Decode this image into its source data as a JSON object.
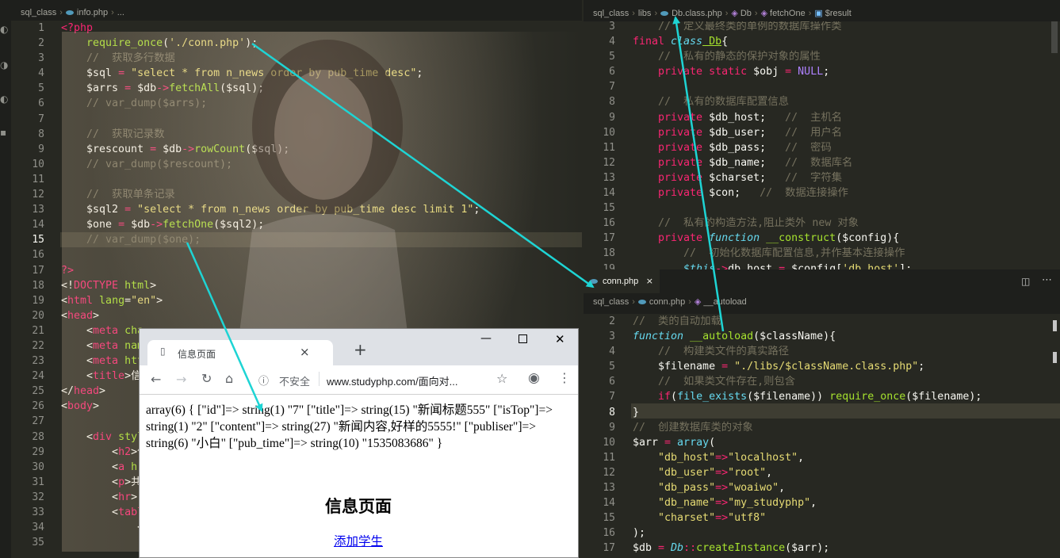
{
  "left_editor": {
    "breadcrumb": {
      "folder": "sql_class",
      "file": "info.php",
      "more": "..."
    },
    "lines": [
      {
        "n": "1",
        "t": [
          [
            "kw",
            "<?php"
          ]
        ]
      },
      {
        "n": "2",
        "t": [
          [
            "fn",
            "    require_once"
          ],
          [
            "vr",
            "("
          ],
          [
            "st",
            "'./conn.php'"
          ],
          [
            "vr",
            ");"
          ]
        ]
      },
      {
        "n": "3",
        "t": [
          [
            "cm",
            "    //  获取多行数据"
          ]
        ]
      },
      {
        "n": "4",
        "t": [
          [
            "vr",
            "    $sql "
          ],
          [
            "kw",
            "="
          ],
          [
            "st",
            " \"select * from n_news order by pub_time desc\""
          ],
          [
            "vr",
            ";"
          ]
        ]
      },
      {
        "n": "5",
        "t": [
          [
            "vr",
            "    $arrs "
          ],
          [
            "kw",
            "="
          ],
          [
            "vr",
            " $db"
          ],
          [
            "kw",
            "->"
          ],
          [
            "fn",
            "fetchAll"
          ],
          [
            "vr",
            "($sql);"
          ]
        ]
      },
      {
        "n": "6",
        "t": [
          [
            "cm",
            "    // var_dump($arrs);"
          ]
        ]
      },
      {
        "n": "7",
        "t": []
      },
      {
        "n": "8",
        "t": [
          [
            "cm",
            "    //  获取记录数"
          ]
        ]
      },
      {
        "n": "9",
        "t": [
          [
            "vr",
            "    $rescount "
          ],
          [
            "kw",
            "="
          ],
          [
            "vr",
            " $db"
          ],
          [
            "kw",
            "->"
          ],
          [
            "fn",
            "rowCount"
          ],
          [
            "vr",
            "($sql);"
          ]
        ]
      },
      {
        "n": "10",
        "t": [
          [
            "cm",
            "    // var_dump($rescount);"
          ]
        ]
      },
      {
        "n": "11",
        "t": []
      },
      {
        "n": "12",
        "t": [
          [
            "cm",
            "    //  获取单条记录"
          ]
        ]
      },
      {
        "n": "13",
        "t": [
          [
            "vr",
            "    $sql2 "
          ],
          [
            "kw",
            "="
          ],
          [
            "st",
            " \"select * from n_news order by pub_time desc limit 1\""
          ],
          [
            "vr",
            ";"
          ]
        ]
      },
      {
        "n": "14",
        "t": [
          [
            "vr",
            "    $one "
          ],
          [
            "kw",
            "="
          ],
          [
            "vr",
            " $db"
          ],
          [
            "kw",
            "->"
          ],
          [
            "fn",
            "fetchOne"
          ],
          [
            "vr",
            "($sql2);"
          ]
        ]
      },
      {
        "n": "15",
        "t": [
          [
            "cm",
            "    // var_dump($one);"
          ]
        ]
      },
      {
        "n": "16",
        "t": []
      },
      {
        "n": "17",
        "t": [
          [
            "kw",
            "?>"
          ]
        ]
      },
      {
        "n": "18",
        "t": [
          [
            "vr",
            "<!"
          ],
          [
            "kw",
            "DOCTYPE"
          ],
          [
            "fn",
            " html"
          ],
          [
            "vr",
            ">"
          ]
        ]
      },
      {
        "n": "19",
        "t": [
          [
            "vr",
            "<"
          ],
          [
            "kw",
            "html"
          ],
          [
            "fn",
            " lang"
          ],
          [
            "vr",
            "="
          ],
          [
            "st",
            "\"en\""
          ],
          [
            "vr",
            ">"
          ]
        ]
      },
      {
        "n": "20",
        "t": [
          [
            "vr",
            "<"
          ],
          [
            "kw",
            "head"
          ],
          [
            "vr",
            ">"
          ]
        ]
      },
      {
        "n": "21",
        "t": [
          [
            "vr",
            "    <"
          ],
          [
            "kw",
            "meta"
          ],
          [
            "fn",
            " cha"
          ]
        ]
      },
      {
        "n": "22",
        "t": [
          [
            "vr",
            "    <"
          ],
          [
            "kw",
            "meta"
          ],
          [
            "fn",
            " nam"
          ]
        ]
      },
      {
        "n": "23",
        "t": [
          [
            "vr",
            "    <"
          ],
          [
            "kw",
            "meta"
          ],
          [
            "fn",
            " htt"
          ]
        ]
      },
      {
        "n": "24",
        "t": [
          [
            "vr",
            "    <"
          ],
          [
            "kw",
            "title"
          ],
          [
            "vr",
            ">信"
          ]
        ]
      },
      {
        "n": "25",
        "t": [
          [
            "vr",
            "</"
          ],
          [
            "kw",
            "head"
          ],
          [
            "vr",
            ">"
          ]
        ]
      },
      {
        "n": "26",
        "t": [
          [
            "vr",
            "<"
          ],
          [
            "kw",
            "body"
          ],
          [
            "vr",
            ">"
          ]
        ]
      },
      {
        "n": "27",
        "t": []
      },
      {
        "n": "28",
        "t": [
          [
            "vr",
            "    <"
          ],
          [
            "kw",
            "div"
          ],
          [
            "fn",
            " styl"
          ]
        ]
      },
      {
        "n": "29",
        "t": [
          [
            "vr",
            "        <"
          ],
          [
            "kw",
            "h2"
          ],
          [
            "vr",
            ">信"
          ]
        ]
      },
      {
        "n": "30",
        "t": [
          [
            "vr",
            "        <"
          ],
          [
            "kw",
            "a"
          ],
          [
            "fn",
            " hr"
          ]
        ]
      },
      {
        "n": "31",
        "t": [
          [
            "vr",
            "        <"
          ],
          [
            "kw",
            "p"
          ],
          [
            "vr",
            ">共"
          ]
        ]
      },
      {
        "n": "32",
        "t": [
          [
            "vr",
            "        <"
          ],
          [
            "kw",
            "hr"
          ],
          [
            "vr",
            ">"
          ]
        ]
      },
      {
        "n": "33",
        "t": [
          [
            "vr",
            "        <"
          ],
          [
            "kw",
            "tabl"
          ]
        ]
      },
      {
        "n": "34",
        "t": [
          [
            "vr",
            "            <"
          ]
        ]
      },
      {
        "n": "35",
        "t": []
      }
    ]
  },
  "right_top_editor": {
    "breadcrumb": {
      "folder": "sql_class",
      "sub": "libs",
      "file": "Db.class.php",
      "cls": "Db",
      "method": "fetchOne",
      "var": "$result"
    },
    "lines": [
      {
        "n": "3",
        "t": [
          [
            "cm",
            "    //  定义最终类的单例的数据库操作类"
          ]
        ]
      },
      {
        "n": "4",
        "t": [
          [
            "kw",
            "final"
          ],
          [
            "ty",
            " class"
          ],
          [
            "cl",
            " Db"
          ],
          [
            "vr",
            "{"
          ]
        ]
      },
      {
        "n": "5",
        "t": [
          [
            "cm",
            "    //  私有的静态的保护对象的属性"
          ]
        ]
      },
      {
        "n": "6",
        "t": [
          [
            "kw",
            "    private static"
          ],
          [
            "vr",
            " $obj "
          ],
          [
            "kw",
            "="
          ],
          [
            "cn",
            " NULL"
          ],
          [
            "vr",
            ";"
          ]
        ]
      },
      {
        "n": "7",
        "t": []
      },
      {
        "n": "8",
        "t": [
          [
            "cm",
            "    //  私有的数据库配置信息"
          ]
        ]
      },
      {
        "n": "9",
        "t": [
          [
            "kw",
            "    private"
          ],
          [
            "vr",
            " $db_host;   "
          ],
          [
            "cm",
            "//  主机名"
          ]
        ]
      },
      {
        "n": "10",
        "t": [
          [
            "kw",
            "    private"
          ],
          [
            "vr",
            " $db_user;   "
          ],
          [
            "cm",
            "//  用户名"
          ]
        ]
      },
      {
        "n": "11",
        "t": [
          [
            "kw",
            "    private"
          ],
          [
            "vr",
            " $db_pass;   "
          ],
          [
            "cm",
            "//  密码"
          ]
        ]
      },
      {
        "n": "12",
        "t": [
          [
            "kw",
            "    private"
          ],
          [
            "vr",
            " $db_name;   "
          ],
          [
            "cm",
            "//  数据库名"
          ]
        ]
      },
      {
        "n": "13",
        "t": [
          [
            "kw",
            "    private"
          ],
          [
            "vr",
            " $charset;   "
          ],
          [
            "cm",
            "//  字符集"
          ]
        ]
      },
      {
        "n": "14",
        "t": [
          [
            "kw",
            "    private"
          ],
          [
            "vr",
            " $con;   "
          ],
          [
            "cm",
            "//  数据连接操作"
          ]
        ]
      },
      {
        "n": "15",
        "t": []
      },
      {
        "n": "16",
        "t": [
          [
            "cm",
            "    //  私有的构造方法,阻止类外 new 对象"
          ]
        ]
      },
      {
        "n": "17",
        "t": [
          [
            "kw",
            "    private"
          ],
          [
            "ty",
            " function"
          ],
          [
            "fn",
            " __construct"
          ],
          [
            "vr",
            "($config){"
          ]
        ]
      },
      {
        "n": "18",
        "t": [
          [
            "cm",
            "        //  初始化数据库配置信息,并作基本连接操作"
          ]
        ]
      },
      {
        "n": "19",
        "t": [
          [
            "vr",
            "        "
          ],
          [
            "ty",
            "$this"
          ],
          [
            "kw",
            "->"
          ],
          [
            "vr",
            "db_host "
          ],
          [
            "kw",
            "="
          ],
          [
            "vr",
            " $config["
          ],
          [
            "st",
            "'db_host'"
          ],
          [
            "vr",
            "];"
          ]
        ]
      }
    ]
  },
  "tab": {
    "label": "conn.php",
    "close": "×"
  },
  "right_bottom_editor": {
    "breadcrumb": {
      "folder": "sql_class",
      "file": "conn.php",
      "func": "__autoload"
    },
    "lines": [
      {
        "n": "2",
        "t": [
          [
            "cm",
            "//  类的自动加载"
          ]
        ]
      },
      {
        "n": "3",
        "t": [
          [
            "ty",
            "function"
          ],
          [
            "fn",
            " __autoload"
          ],
          [
            "vr",
            "($className){"
          ]
        ]
      },
      {
        "n": "4",
        "t": [
          [
            "cm",
            "    //  构建类文件的真实路径"
          ]
        ]
      },
      {
        "n": "5",
        "t": [
          [
            "vr",
            "    $filename "
          ],
          [
            "kw",
            "="
          ],
          [
            "st",
            " \"./libs/$className.class.php\""
          ],
          [
            "vr",
            ";"
          ]
        ]
      },
      {
        "n": "6",
        "t": [
          [
            "cm",
            "    //  如果类文件存在,则包含"
          ]
        ]
      },
      {
        "n": "7",
        "t": [
          [
            "kw",
            "    if"
          ],
          [
            "vr",
            "("
          ],
          [
            "bl",
            "file_exists"
          ],
          [
            "vr",
            "($filename)) "
          ],
          [
            "fn",
            "require_once"
          ],
          [
            "vr",
            "($filename);"
          ]
        ]
      },
      {
        "n": "8",
        "t": [
          [
            "vr",
            "}"
          ]
        ]
      },
      {
        "n": "9",
        "t": [
          [
            "cm",
            "//  创建数据库类的对象"
          ]
        ]
      },
      {
        "n": "10",
        "t": [
          [
            "vr",
            "$arr "
          ],
          [
            "kw",
            "="
          ],
          [
            "bl",
            " array"
          ],
          [
            "vr",
            "("
          ]
        ]
      },
      {
        "n": "11",
        "t": [
          [
            "st",
            "    \"db_host\""
          ],
          [
            "kw",
            "=>"
          ],
          [
            "st",
            "\"localhost\""
          ],
          [
            "vr",
            ","
          ]
        ]
      },
      {
        "n": "12",
        "t": [
          [
            "st",
            "    \"db_user\""
          ],
          [
            "kw",
            "=>"
          ],
          [
            "st",
            "\"root\""
          ],
          [
            "vr",
            ","
          ]
        ]
      },
      {
        "n": "13",
        "t": [
          [
            "st",
            "    \"db_pass\""
          ],
          [
            "kw",
            "=>"
          ],
          [
            "st",
            "\"woaiwo\""
          ],
          [
            "vr",
            ","
          ]
        ]
      },
      {
        "n": "14",
        "t": [
          [
            "st",
            "    \"db_name\""
          ],
          [
            "kw",
            "=>"
          ],
          [
            "st",
            "\"my_studyphp\""
          ],
          [
            "vr",
            ","
          ]
        ]
      },
      {
        "n": "15",
        "t": [
          [
            "st",
            "    \"charset\""
          ],
          [
            "kw",
            "=>"
          ],
          [
            "st",
            "\"utf8\""
          ]
        ]
      },
      {
        "n": "16",
        "t": [
          [
            "vr",
            ");"
          ]
        ]
      },
      {
        "n": "17",
        "t": [
          [
            "vr",
            "$db "
          ],
          [
            "kw",
            "="
          ],
          [
            "ty",
            " Db"
          ],
          [
            "kw",
            "::"
          ],
          [
            "fn",
            "createInstance"
          ],
          [
            "vr",
            "($arr);"
          ]
        ]
      }
    ]
  },
  "browser": {
    "tab_title": "信息页面",
    "tab_close": "×",
    "new_tab": "+",
    "security": "不安全",
    "url": "www.studyphp.com/面向对...",
    "dump_text": "array(6) { [\"id\"]=> string(1) \"7\" [\"title\"]=> string(15) \"新闻标题555\" [\"isTop\"]=> string(1) \"2\" [\"content\"]=> string(27) \"新闻内容,好样的5555!\" [\"publiser\"]=> string(6) \"小白\" [\"pub_time\"]=> string(10) \"1535083686\" }",
    "heading": "信息页面",
    "link": "添加学生"
  },
  "colors": {
    "editor_bg": "#272822",
    "arrow": "#1ed4d4",
    "keyword": "#f92672",
    "string": "#e6db74",
    "function": "#a6e22e",
    "comment": "#75715e"
  }
}
